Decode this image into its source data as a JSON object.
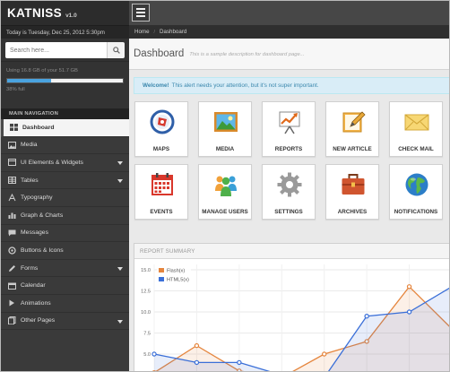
{
  "app": {
    "name": "KATNISS",
    "version": "v1.0"
  },
  "date_text": "Today is Tuesday, Dec 25, 2012 5:30pm",
  "search": {
    "placeholder": "Search here..."
  },
  "usage": {
    "text": "Using 16.8 GB of your 51.7 GB",
    "percent_label": "38% full",
    "percent": 38
  },
  "nav": {
    "heading": "MAIN NAVIGATION",
    "items": [
      {
        "label": "Dashboard",
        "icon": "dashboard-icon",
        "active": true,
        "caret": false
      },
      {
        "label": "Media",
        "icon": "image-icon",
        "active": false,
        "caret": false
      },
      {
        "label": "UI Elements & Widgets",
        "icon": "widgets-icon",
        "active": false,
        "caret": true
      },
      {
        "label": "Tables",
        "icon": "table-icon",
        "active": false,
        "caret": true
      },
      {
        "label": "Typography",
        "icon": "typography-icon",
        "active": false,
        "caret": false
      },
      {
        "label": "Graph & Charts",
        "icon": "chart-icon",
        "active": false,
        "caret": false
      },
      {
        "label": "Messages",
        "icon": "messages-icon",
        "active": false,
        "caret": false
      },
      {
        "label": "Buttons & Icons",
        "icon": "buttons-icon",
        "active": false,
        "caret": false
      },
      {
        "label": "Forms",
        "icon": "pencil-icon",
        "active": false,
        "caret": true
      },
      {
        "label": "Calendar",
        "icon": "calendar-icon",
        "active": false,
        "caret": false
      },
      {
        "label": "Animations",
        "icon": "play-icon",
        "active": false,
        "caret": false
      },
      {
        "label": "Other Pages",
        "icon": "pages-icon",
        "active": false,
        "caret": true
      }
    ]
  },
  "breadcrumb": {
    "home": "Home",
    "current": "Dashboard"
  },
  "page": {
    "title": "Dashboard",
    "description": "This is a sample description for dashboard page..."
  },
  "alert": {
    "strong": "Welcome!",
    "text": "This alert needs your attention, but it's not super important."
  },
  "tiles": [
    {
      "label": "MAPS",
      "icon": "compass-icon"
    },
    {
      "label": "MEDIA",
      "icon": "picture-icon"
    },
    {
      "label": "REPORTS",
      "icon": "report-chart-icon"
    },
    {
      "label": "NEW ARTICLE",
      "icon": "edit-note-icon"
    },
    {
      "label": "CHECK MAIL",
      "icon": "envelope-icon"
    },
    {
      "label": "EVENTS",
      "icon": "calendar-icon"
    },
    {
      "label": "MANAGE USERS",
      "icon": "users-icon"
    },
    {
      "label": "SETTINGS",
      "icon": "gear-icon"
    },
    {
      "label": "ARCHIVES",
      "icon": "briefcase-icon"
    },
    {
      "label": "NOTIFICATIONS",
      "icon": "globe-icon"
    }
  ],
  "report": {
    "title": "REPORT SUMMARY"
  },
  "colors": {
    "flash": "#e5853d",
    "html5": "#3a6fd8",
    "accent": "#4aa3df"
  },
  "chart_data": {
    "type": "area",
    "title": "",
    "ylim": [
      3,
      15
    ],
    "yticks": [
      "15.0",
      "12.5",
      "10.0",
      "7.5",
      "5.0"
    ],
    "ytick_values": [
      15,
      12.5,
      10,
      7.5,
      5
    ],
    "x": [
      0,
      1,
      2,
      3,
      4,
      5,
      6,
      7
    ],
    "legend_position": "top-left",
    "series": [
      {
        "name": "Flash(x)",
        "values": [
          2.8,
          6.0,
          3.0,
          2.2,
          5.0,
          6.5,
          13.0,
          8.0
        ]
      },
      {
        "name": "HTML5(x)",
        "values": [
          5.0,
          4.0,
          4.0,
          2.5,
          2.2,
          9.5,
          10.0,
          13.0
        ]
      }
    ]
  }
}
